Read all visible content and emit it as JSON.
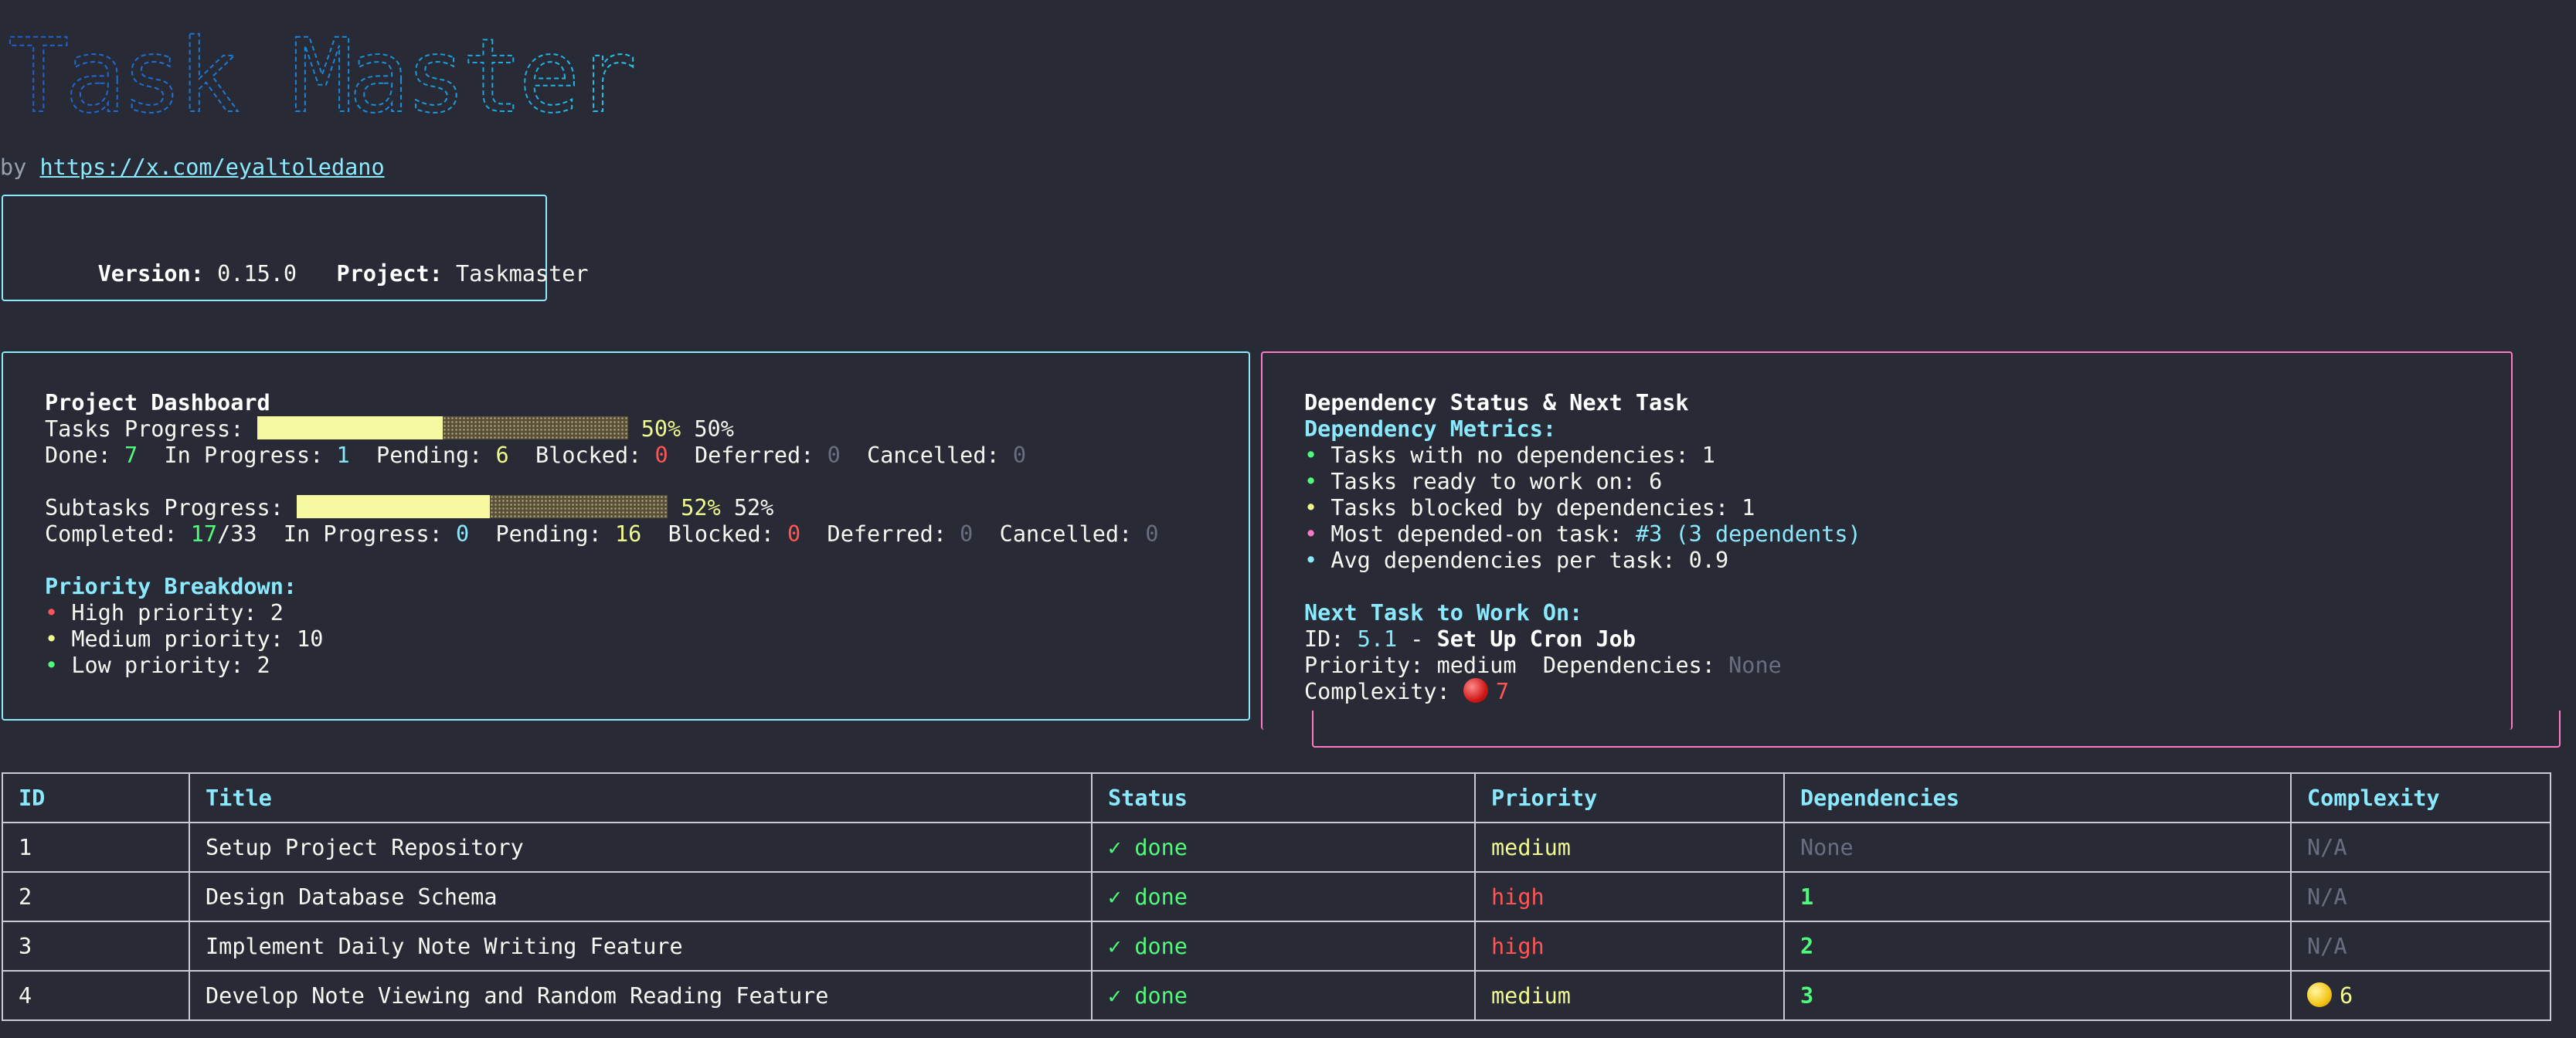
{
  "banner": {
    "text": "Task Master",
    "colors": [
      "#1f6fd6",
      "#1aa7d8",
      "#21c3e8"
    ]
  },
  "byline": {
    "prefix": "by ",
    "link": "https://x.com/eyaltoledano"
  },
  "version_box": {
    "version_label": "Version:",
    "version": "0.15.0",
    "project_label": "Project:",
    "project": "Taskmaster"
  },
  "dashboard": {
    "title": "Project Dashboard",
    "tasks_progress_label": "Tasks Progress:",
    "tasks_progress": 0.5,
    "tasks_pct_colored": "50%",
    "tasks_pct": "50%",
    "done_label": "Done:",
    "done": "7",
    "in_progress_label": "In Progress:",
    "in_progress": "1",
    "pending_label": "Pending:",
    "pending": "6",
    "blocked_label": "Blocked:",
    "blocked": "0",
    "deferred_label": "Deferred:",
    "deferred": "0",
    "cancelled_label": "Cancelled:",
    "cancelled": "0",
    "subtasks_progress_label": "Subtasks Progress:",
    "subtasks_progress": 0.52,
    "subtasks_pct_colored": "52%",
    "subtasks_pct": "52%",
    "completed_label": "Completed:",
    "completed": "17",
    "completed_total": "/33",
    "sub_in_progress": "0",
    "sub_pending": "16",
    "sub_blocked": "0",
    "sub_deferred": "0",
    "sub_cancelled": "0",
    "priority_title": "Priority Breakdown:",
    "priorities": [
      {
        "bullet": "•",
        "label": "High priority: 2",
        "color": "#ff5555"
      },
      {
        "bullet": "•",
        "label": "Medium priority: 10",
        "color": "#f1fa8c"
      },
      {
        "bullet": "•",
        "label": "Low priority: 2",
        "color": "#50fa7b"
      }
    ]
  },
  "dependency": {
    "title": "Dependency Status & Next Task",
    "metrics_title": "Dependency Metrics:",
    "metrics": [
      {
        "bullet": "•",
        "text": "Tasks with no dependencies: 1",
        "color": "#50fa7b"
      },
      {
        "bullet": "•",
        "text": "Tasks ready to work on: 6",
        "color": "#50fa7b"
      },
      {
        "bullet": "•",
        "text": "Tasks blocked by dependencies: 1",
        "color": "#f1fa8c"
      },
      {
        "bullet": "•",
        "text_prefix": "Most depended-on task: ",
        "text_highlight": "#3 (3 dependents)",
        "color": "#ff79c6"
      },
      {
        "bullet": "•",
        "text": "Avg dependencies per task: 0.9",
        "color": "#8be9fd"
      }
    ],
    "next_title": "Next Task to Work On:",
    "id_label": "ID:",
    "id": "5.1",
    "id_sep": " - ",
    "task_title": "Set Up Cron Job",
    "priority_label": "Priority:",
    "priority": "medium",
    "deps_label": "Dependencies:",
    "deps": "None",
    "complexity_label": "Complexity:",
    "complexity_icon": "red-circle",
    "complexity": "7"
  },
  "table": {
    "headers": [
      "ID",
      "Title",
      "Status",
      "Priority",
      "Dependencies",
      "Complexity"
    ],
    "rows": [
      {
        "id": "1",
        "title": "Setup Project Repository",
        "status": "✓ done",
        "priority": "medium",
        "deps": "None",
        "complexity": "N/A"
      },
      {
        "id": "2",
        "title": "Design Database Schema",
        "status": "✓ done",
        "priority": "high",
        "deps": "1",
        "complexity": "N/A"
      },
      {
        "id": "3",
        "title": "Implement Daily Note Writing Feature",
        "status": "✓ done",
        "priority": "high",
        "deps": "2",
        "complexity": "N/A"
      },
      {
        "id": "4",
        "title": "Develop Note Viewing and Random Reading Feature",
        "status": "✓ done",
        "priority": "medium",
        "deps": "3",
        "complexity": "6",
        "complexity_icon": "yellow-circle"
      }
    ]
  }
}
